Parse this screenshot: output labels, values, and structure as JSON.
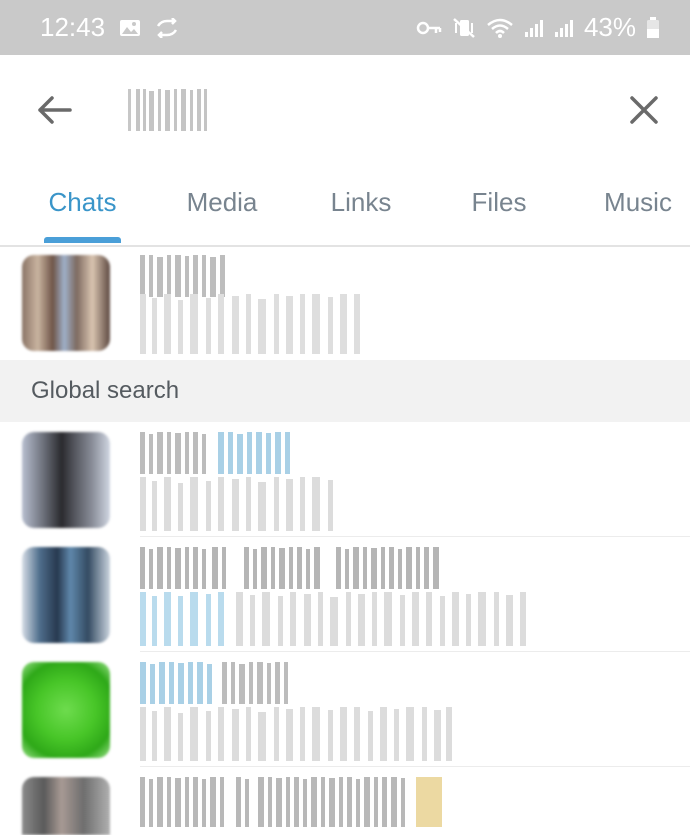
{
  "status_bar": {
    "time": "12:43",
    "battery": "43%",
    "icons": [
      "image-icon",
      "sync-icon",
      "key-icon",
      "vibrate-icon",
      "wifi-icon",
      "signal-icon",
      "signal-icon-2",
      "battery-icon"
    ]
  },
  "header": {
    "back_icon": "arrow-left-icon",
    "close_icon": "close-icon",
    "search_value": ""
  },
  "tabs": [
    {
      "label": "Chats",
      "active": true
    },
    {
      "label": "Media",
      "active": false
    },
    {
      "label": "Links",
      "active": false
    },
    {
      "label": "Files",
      "active": false
    },
    {
      "label": "Music",
      "active": false
    }
  ],
  "local_results": [
    {
      "title": "",
      "subtitle": ""
    }
  ],
  "global_search": {
    "header": "Global search",
    "results": [
      {
        "title": "",
        "subtitle": ""
      },
      {
        "title": "",
        "subtitle": ""
      },
      {
        "title": "",
        "subtitle": ""
      },
      {
        "title": "",
        "subtitle": ""
      }
    ]
  },
  "colors": {
    "accent": "#3a95c9",
    "tab_inactive": "#78848f",
    "status_bar": "#c9c9c9",
    "section_bg": "#f2f2f2"
  }
}
